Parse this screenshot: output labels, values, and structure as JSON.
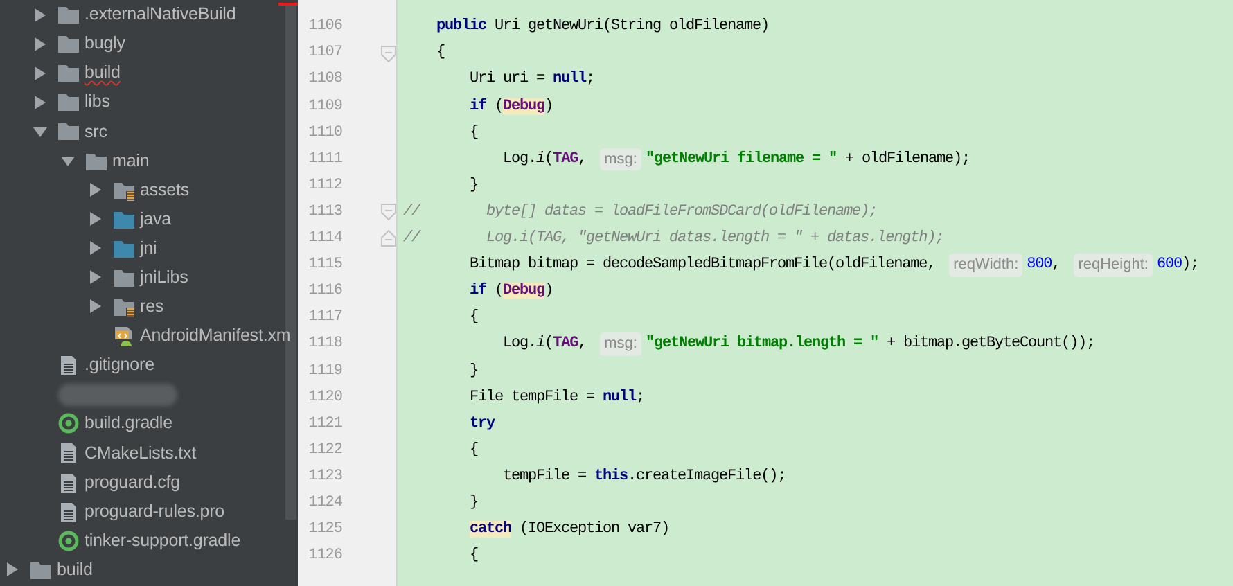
{
  "project_tree": {
    "module_children": [
      {
        "label": ".externalNativeBuild",
        "kind": "folder",
        "expanded": false,
        "error": false
      },
      {
        "label": "bugly",
        "kind": "folder",
        "expanded": false,
        "error": false
      },
      {
        "label": "build",
        "kind": "folder",
        "expanded": false,
        "error": true
      },
      {
        "label": "libs",
        "kind": "folder",
        "expanded": false,
        "error": false
      },
      {
        "label": "src",
        "kind": "folder",
        "expanded": true,
        "error": false,
        "children": [
          {
            "label": "main",
            "kind": "folder",
            "expanded": true,
            "error": false,
            "children": [
              {
                "label": "assets",
                "kind": "resource-folder",
                "expanded": false,
                "error": false
              },
              {
                "label": "java",
                "kind": "source-folder",
                "expanded": false,
                "error": false
              },
              {
                "label": "jni",
                "kind": "source-folder",
                "expanded": false,
                "error": false
              },
              {
                "label": "jniLibs",
                "kind": "folder",
                "expanded": false,
                "error": false
              },
              {
                "label": "res",
                "kind": "resource-folder",
                "expanded": false,
                "error": false
              },
              {
                "label": "AndroidManifest.xm",
                "kind": "manifest",
                "error": false
              }
            ]
          }
        ]
      },
      {
        "label": ".gitignore",
        "kind": "file",
        "error": false
      },
      {
        "kind": "blurred"
      },
      {
        "label": "build.gradle",
        "kind": "gradle",
        "error": false
      },
      {
        "label": "CMakeLists.txt",
        "kind": "file",
        "error": false
      },
      {
        "label": "proguard.cfg",
        "kind": "file",
        "error": false
      },
      {
        "label": "proguard-rules.pro",
        "kind": "file",
        "error": false
      },
      {
        "label": "tinker-support.gradle",
        "kind": "gradle",
        "error": false
      }
    ],
    "root_items": [
      {
        "label": "build",
        "kind": "folder",
        "expanded": false,
        "error": false
      }
    ]
  },
  "editor": {
    "lines": [
      {
        "number": "1106",
        "tokens": [
          {
            "text": "    public ",
            "kind": "keyword"
          },
          {
            "text": "Uri getNewUri(String oldFilename)",
            "kind": "plain"
          }
        ]
      },
      {
        "number": "1107",
        "fold_marker": {
          "kind": "start"
        },
        "tokens": [
          {
            "text": "    {",
            "kind": "plain"
          }
        ]
      },
      {
        "number": "1108",
        "tokens": [
          {
            "text": "        Uri uri = ",
            "kind": "plain"
          },
          {
            "text": "null",
            "kind": "keyword"
          },
          {
            "text": ";",
            "kind": "plain"
          }
        ]
      },
      {
        "number": "1109",
        "tokens": [
          {
            "text": "        if ",
            "kind": "keyword"
          },
          {
            "text": "(",
            "kind": "plain"
          },
          {
            "text": "Debug",
            "kind": "field",
            "highlighted": true
          },
          {
            "text": ")",
            "kind": "plain"
          }
        ]
      },
      {
        "number": "1110",
        "tokens": [
          {
            "text": "        {",
            "kind": "plain"
          }
        ]
      },
      {
        "number": "1111",
        "tokens": [
          {
            "text": "            Log.",
            "kind": "plain"
          },
          {
            "text": "i",
            "kind": "static"
          },
          {
            "text": "(",
            "kind": "plain"
          },
          {
            "text": "TAG",
            "kind": "field"
          },
          {
            "text": ", ",
            "kind": "plain"
          },
          {
            "text": "msg:",
            "kind": "hint"
          },
          {
            "text": "\"getNewUri filename = \"",
            "kind": "string"
          },
          {
            "text": " + oldFilename);",
            "kind": "plain"
          }
        ]
      },
      {
        "number": "1112",
        "tokens": [
          {
            "text": "        }",
            "kind": "plain"
          }
        ]
      },
      {
        "number": "1113",
        "fold_marker": {
          "kind": "start"
        },
        "tokens": [
          {
            "text": "//        byte[] datas = loadFileFromSDCard(oldFilename);",
            "kind": "comment"
          }
        ]
      },
      {
        "number": "1114",
        "fold_marker": {
          "kind": "end"
        },
        "tokens": [
          {
            "text": "//        Log.i(TAG, \"getNewUri datas.length = \" + datas.length);",
            "kind": "comment"
          }
        ]
      },
      {
        "number": "1115",
        "tokens": [
          {
            "text": "        Bitmap bitmap = decodeSampledBitmapFromFile(oldFilename, ",
            "kind": "plain"
          },
          {
            "text": "reqWidth:",
            "kind": "hint"
          },
          {
            "text": "800",
            "kind": "number"
          },
          {
            "text": ", ",
            "kind": "plain"
          },
          {
            "text": "reqHeight:",
            "kind": "hint"
          },
          {
            "text": "600",
            "kind": "number"
          },
          {
            "text": ");",
            "kind": "plain"
          }
        ]
      },
      {
        "number": "1116",
        "tokens": [
          {
            "text": "        if ",
            "kind": "keyword"
          },
          {
            "text": "(",
            "kind": "plain"
          },
          {
            "text": "Debug",
            "kind": "field",
            "highlighted": true
          },
          {
            "text": ")",
            "kind": "plain"
          }
        ]
      },
      {
        "number": "1117",
        "tokens": [
          {
            "text": "        {",
            "kind": "plain"
          }
        ]
      },
      {
        "number": "1118",
        "tokens": [
          {
            "text": "            Log.",
            "kind": "plain"
          },
          {
            "text": "i",
            "kind": "static"
          },
          {
            "text": "(",
            "kind": "plain"
          },
          {
            "text": "TAG",
            "kind": "field"
          },
          {
            "text": ", ",
            "kind": "plain"
          },
          {
            "text": "msg:",
            "kind": "hint"
          },
          {
            "text": "\"getNewUri bitmap.length = \"",
            "kind": "string"
          },
          {
            "text": " + bitmap.getByteCount());",
            "kind": "plain"
          }
        ]
      },
      {
        "number": "1119",
        "tokens": [
          {
            "text": "        }",
            "kind": "plain"
          }
        ]
      },
      {
        "number": "1120",
        "tokens": [
          {
            "text": "        File tempFile = ",
            "kind": "plain"
          },
          {
            "text": "null",
            "kind": "keyword"
          },
          {
            "text": ";",
            "kind": "plain"
          }
        ]
      },
      {
        "number": "1121",
        "tokens": [
          {
            "text": "        try",
            "kind": "keyword"
          }
        ]
      },
      {
        "number": "1122",
        "tokens": [
          {
            "text": "        {",
            "kind": "plain"
          }
        ]
      },
      {
        "number": "1123",
        "tokens": [
          {
            "text": "            tempFile = ",
            "kind": "plain"
          },
          {
            "text": "this",
            "kind": "keyword"
          },
          {
            "text": ".createImageFile();",
            "kind": "plain"
          }
        ]
      },
      {
        "number": "1124",
        "tokens": [
          {
            "text": "        }",
            "kind": "plain"
          }
        ]
      },
      {
        "number": "1125",
        "tokens": [
          {
            "text": "        catch",
            "kind": "keyword",
            "highlighted": true
          },
          {
            "text": " (IOException var7)",
            "kind": "plain"
          }
        ]
      },
      {
        "number": "1126",
        "tokens": [
          {
            "text": "        {",
            "kind": "plain"
          }
        ]
      }
    ]
  }
}
